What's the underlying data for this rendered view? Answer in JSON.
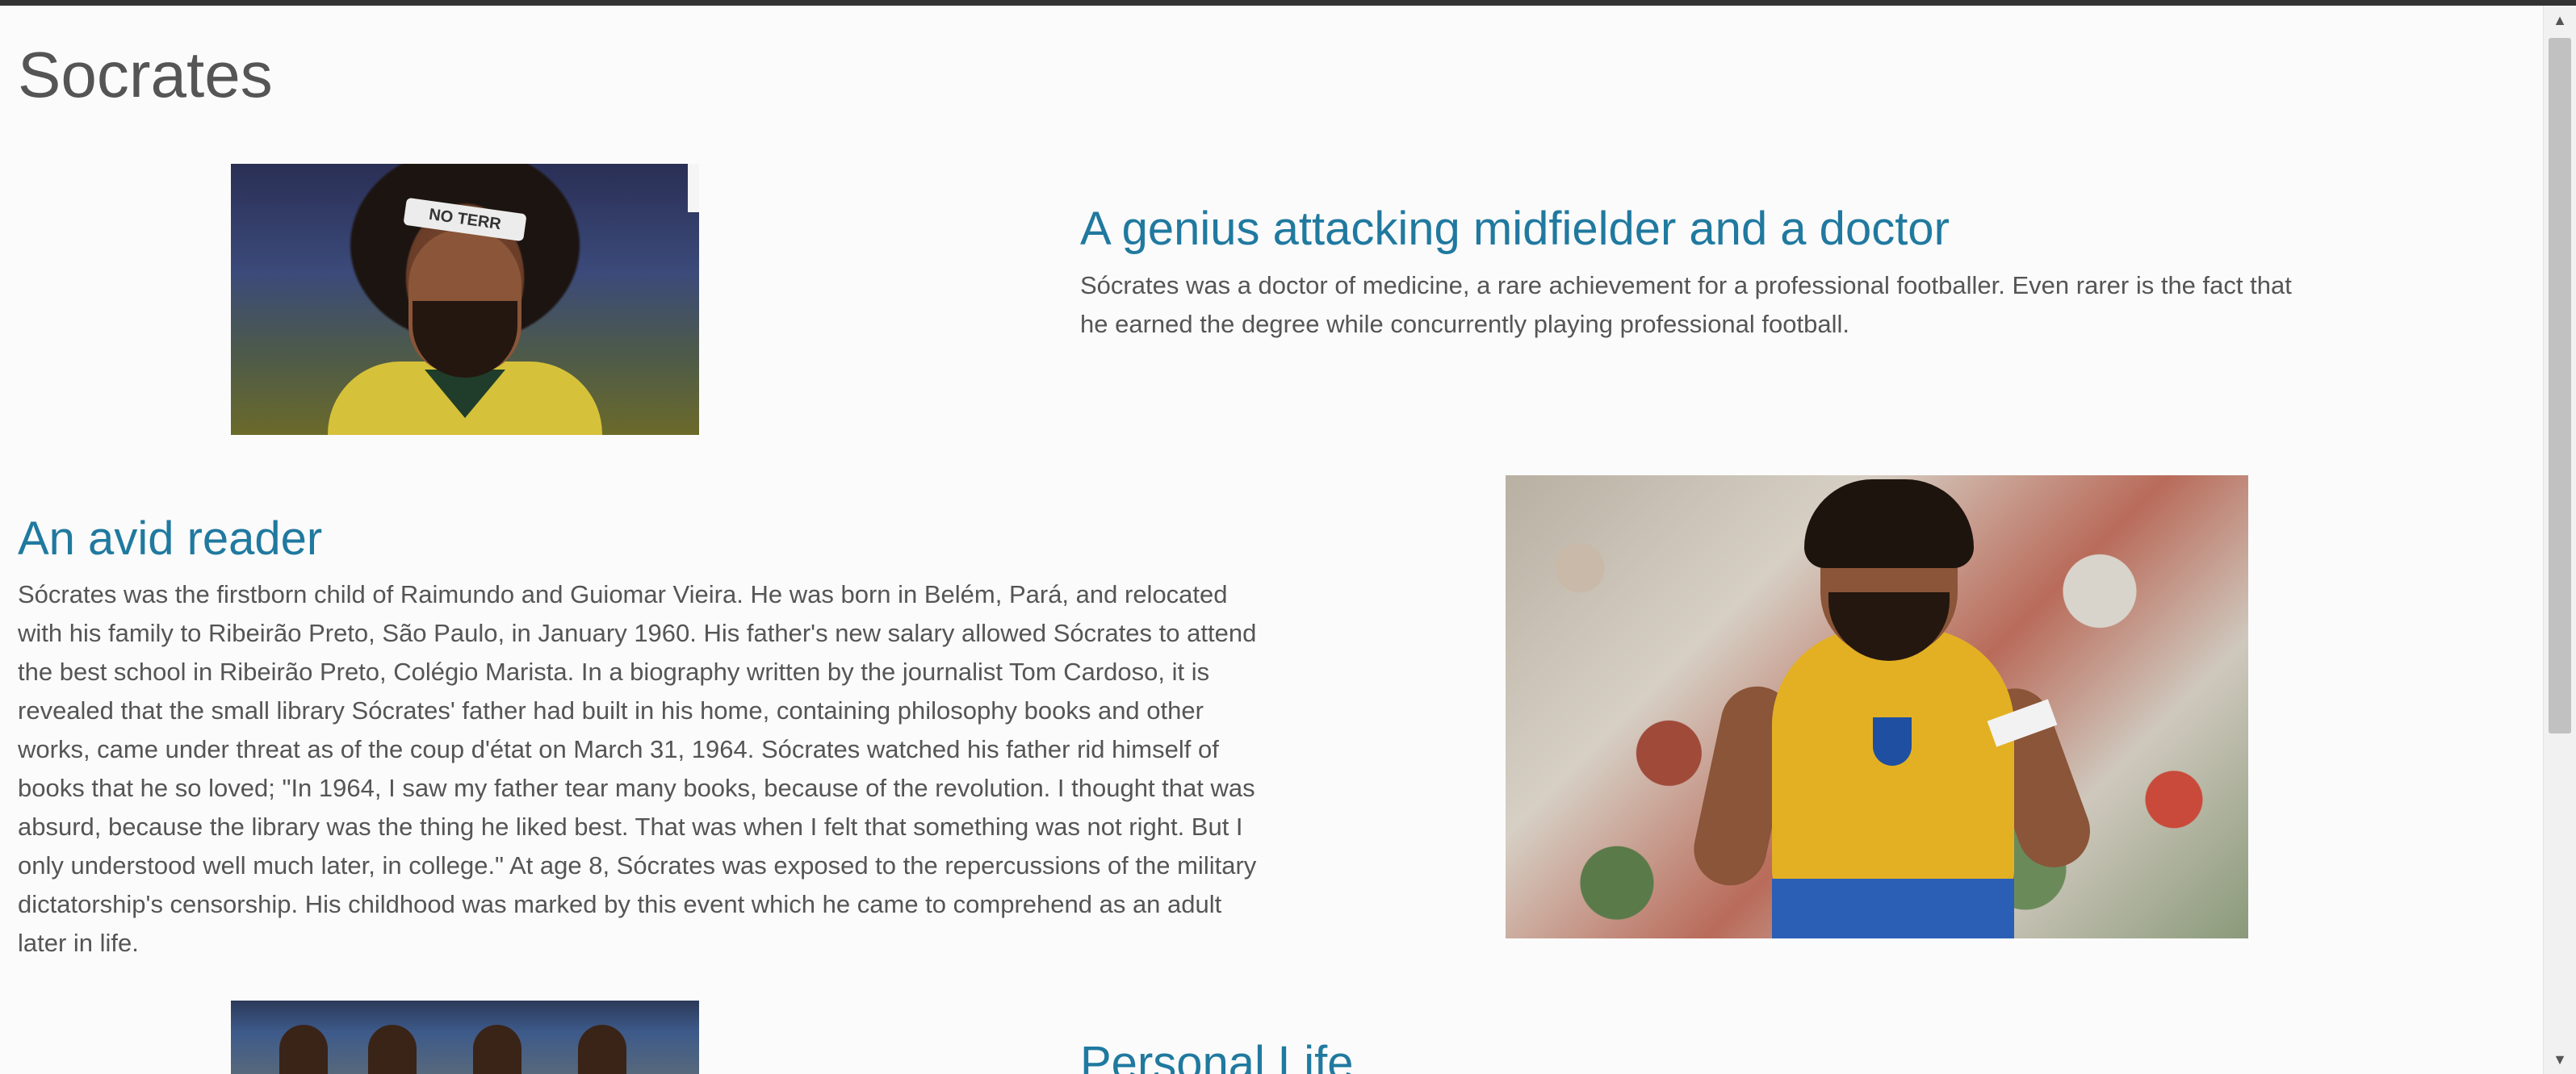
{
  "page": {
    "title": "Socrates"
  },
  "sections": [
    {
      "heading": "A genius attacking midfielder and a doctor",
      "text": "Sócrates was a doctor of medicine, a rare achievement for a professional footballer. Even rarer is the fact that he earned the degree while concurrently playing professional football."
    },
    {
      "heading": "An avid reader",
      "text": "Sócrates was the firstborn child of Raimundo and Guiomar Vieira. He was born in Belém, Pará, and relocated with his family to Ribeirão Preto, São Paulo, in January 1960. His father's new salary allowed Sócrates to attend the best school in Ribeirão Preto, Colégio Marista. In a biography written by the journalist Tom Cardoso, it is revealed that the small library Sócrates' father had built in his home, containing philosophy books and other works, came under threat as of the coup d'état on March 31, 1964. Sócrates watched his father rid himself of books that he so loved; \"In 1964, I saw my father tear many books, because of the revolution. I thought that was absurd, because the library was the thing he liked best. That was when I felt that something was not right. But I only understood well much later, in college.\" At age 8, Sócrates was exposed to the repercussions of the military dictatorship's censorship. His childhood was marked by this event which he came to comprehend as an adult later in life."
    },
    {
      "heading": "Personal Life"
    }
  ],
  "photo1": {
    "headband_text": "NO TERR"
  },
  "scrollbar": {
    "up_icon": "▲",
    "down_icon": "▼"
  }
}
